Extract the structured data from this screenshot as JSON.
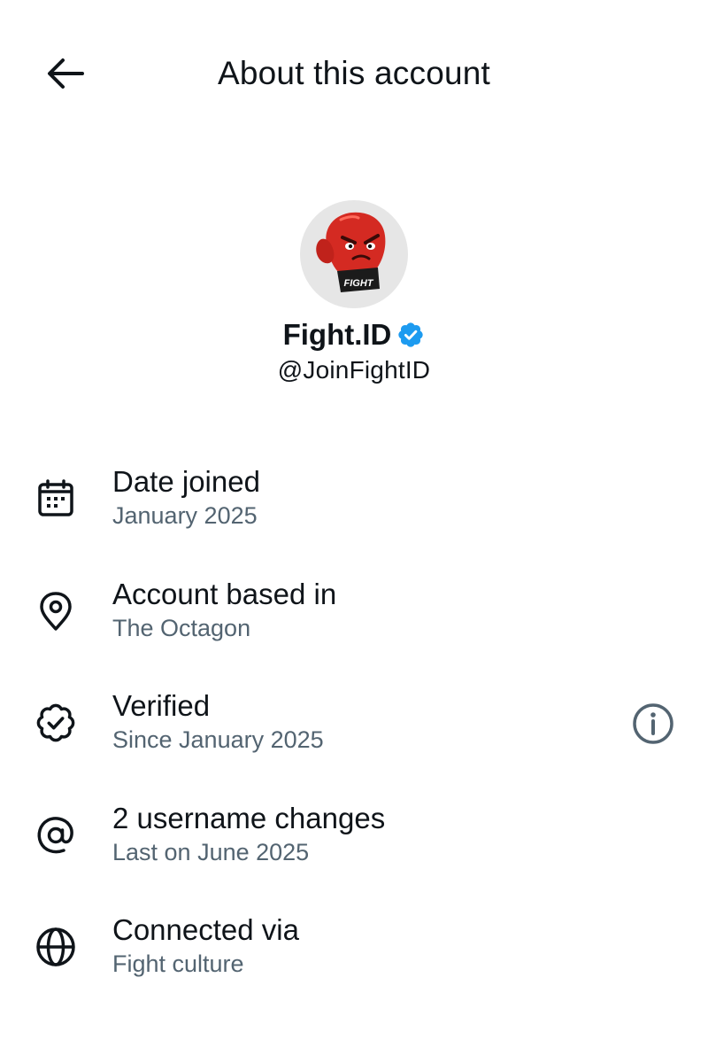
{
  "header": {
    "title": "About this account",
    "back_icon": "arrow-left-icon"
  },
  "profile": {
    "display_name": "Fight.ID",
    "handle": "@JoinFightID",
    "verified": true,
    "verified_color": "#1d9bf0",
    "avatar_text": "FIGHT"
  },
  "info": {
    "rows": [
      {
        "icon": "calendar-icon",
        "title": "Date joined",
        "subtitle": "January 2025"
      },
      {
        "icon": "location-pin-icon",
        "title": "Account based in",
        "subtitle": "The Octagon"
      },
      {
        "icon": "verified-badge-icon",
        "title": "Verified",
        "subtitle": "Since January 2025",
        "extra_icon": "info-icon"
      },
      {
        "icon": "at-sign-icon",
        "title": "2 username changes",
        "subtitle": "Last on June 2025"
      },
      {
        "icon": "globe-icon",
        "title": "Connected via",
        "subtitle": "Fight culture"
      }
    ]
  },
  "colors": {
    "text_primary": "#0f1419",
    "text_secondary": "#536471",
    "avatar_bg": "#e6e6e6",
    "glove_red": "#d42a22"
  }
}
